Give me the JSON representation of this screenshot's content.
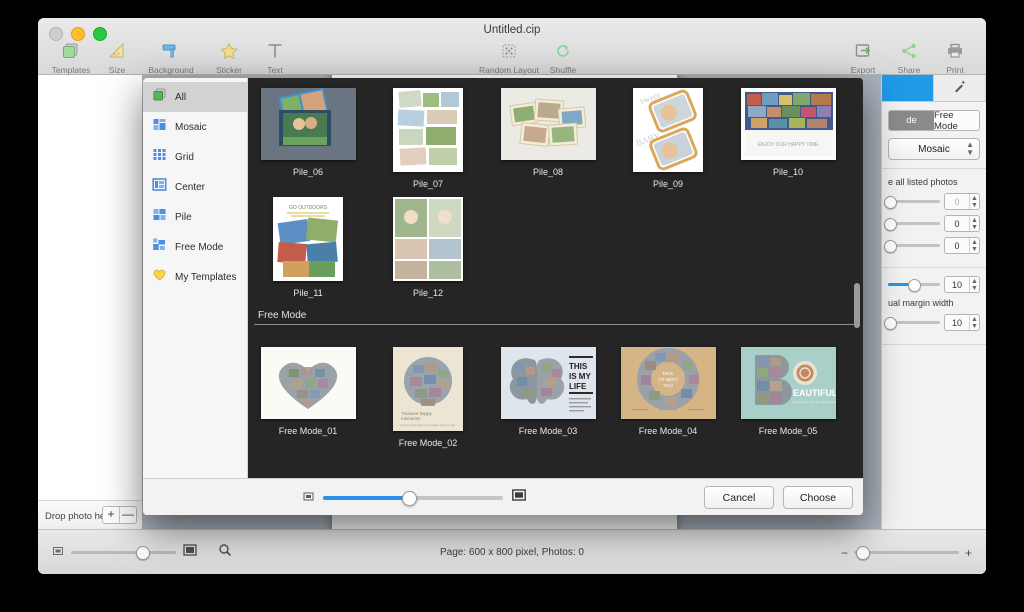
{
  "window": {
    "title": "Untitled.cip",
    "traffic_lights": [
      "gray",
      "yellow",
      "green"
    ]
  },
  "toolbar": {
    "left_items": [
      {
        "label": "Templates",
        "icon": "templates-icon"
      },
      {
        "label": "Size",
        "icon": "size-icon"
      },
      {
        "label": "Background",
        "icon": "background-icon"
      }
    ],
    "mid_items": [
      {
        "label": "Sticker",
        "icon": "star-icon"
      },
      {
        "label": "Text",
        "icon": "text-icon"
      }
    ],
    "center_items": [
      {
        "label": "Random Layout",
        "icon": "random-layout-icon"
      },
      {
        "label": "Shuffle",
        "icon": "shuffle-icon"
      }
    ],
    "right_items": [
      {
        "label": "Export",
        "icon": "export-icon"
      },
      {
        "label": "Share",
        "icon": "share-icon"
      },
      {
        "label": "Print",
        "icon": "print-icon"
      }
    ]
  },
  "photo_tray": {
    "drop_label": "Drop photo here",
    "add_label": "+",
    "remove_label": "—"
  },
  "right_panel": {
    "tabs": [
      {
        "icon": "layout-tab-icon",
        "selected": true
      },
      {
        "icon": "magic-wand-icon",
        "selected": false
      }
    ],
    "segment": {
      "left_label": "de",
      "right_label": "Free Mode",
      "active": "left"
    },
    "popup_value": "Mosaic",
    "section_label": "e all listed photos",
    "rows": [
      {
        "value": "0",
        "dim": true,
        "fill_pct": 0
      },
      {
        "value": "0",
        "dim": false,
        "fill_pct": 0
      },
      {
        "value": "0",
        "dim": false,
        "fill_pct": 0
      }
    ],
    "margin_row": {
      "value": "10",
      "fill_pct": 42
    },
    "margin_label": "ual margin width",
    "margin_value": "10"
  },
  "status_bar": {
    "page_info": "Page: 600 x 800 pixel, Photos: 0",
    "minus": "−",
    "plus": "+"
  },
  "sheet": {
    "categories": [
      {
        "label": "All",
        "icon": "all-icon",
        "selected": true
      },
      {
        "label": "Mosaic",
        "icon": "mosaic-icon",
        "selected": false
      },
      {
        "label": "Grid",
        "icon": "grid-icon",
        "selected": false
      },
      {
        "label": "Center",
        "icon": "center-icon",
        "selected": false
      },
      {
        "label": "Pile",
        "icon": "pile-icon",
        "selected": false
      },
      {
        "label": "Free Mode",
        "icon": "free-mode-icon",
        "selected": false
      },
      {
        "label": "My Templates",
        "icon": "heart-icon",
        "selected": false
      }
    ],
    "pile_row1": [
      {
        "name": "Pile_06",
        "style": "dark"
      },
      {
        "name": "Pile_07",
        "style": "tall-white"
      },
      {
        "name": "Pile_08",
        "style": "light"
      },
      {
        "name": "Pile_09",
        "style": "tall-white"
      },
      {
        "name": "Pile_10",
        "style": "light"
      }
    ],
    "pile_row2": [
      {
        "name": "Pile_11",
        "style": "tall-white"
      },
      {
        "name": "Pile_12",
        "style": "tall-white"
      }
    ],
    "free_mode_header": "Free Mode",
    "free_mode_row": [
      {
        "name": "Free Mode_01",
        "style": "light"
      },
      {
        "name": "Free Mode_02",
        "style": "tall-cream"
      },
      {
        "name": "Free Mode_03",
        "style": "blue"
      },
      {
        "name": "Free Mode_04",
        "style": "tan"
      },
      {
        "name": "Free Mode_05",
        "style": "teal"
      }
    ],
    "footer": {
      "small_icon": "small-thumbnail-icon",
      "large_icon": "large-thumbnail-icon",
      "slider_pct": 48,
      "cancel_label": "Cancel",
      "choose_label": "Choose"
    }
  },
  "colors": {
    "accent": "#2b8fec",
    "sheet_bg": "#252525",
    "selected_tab": "#1e9ae6"
  }
}
